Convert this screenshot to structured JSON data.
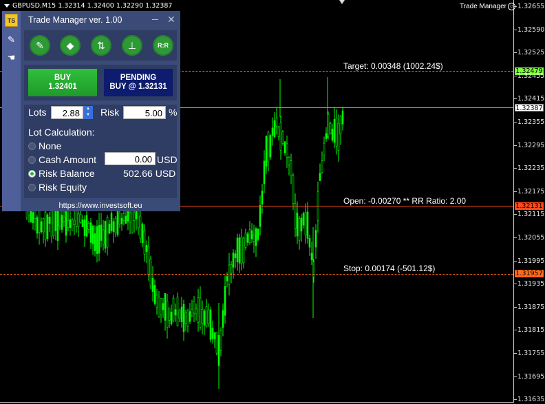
{
  "chart": {
    "symbol_line": "GBPUSD,M15  1.32314 1.32400 1.32290 1.32387",
    "ea_name": "Trade Manager",
    "ea_icon": "smile-icon",
    "price_axis": [
      "1.32655",
      "1.32590",
      "1.32525",
      "1.32455",
      "1.32415",
      "1.32355",
      "1.32295",
      "1.32235",
      "1.32175",
      "1.32115",
      "1.32055",
      "1.31995",
      "1.31935",
      "1.31875",
      "1.31815",
      "1.31755",
      "1.31695",
      "1.31635"
    ],
    "current_price_tag": "1.32387",
    "target_price_tag": "1.32479",
    "open_price_tag": "1.32131",
    "stop_price_tag": "1.31957",
    "target_text": "Target: 0.00348 (1002.24$)",
    "open_text": "Open: -0.00270 ** RR Ratio: 2.00",
    "stop_text": "Stop: 0.00174 (-501.12$)",
    "colors": {
      "candle": "#00ff00",
      "target": "#4caf50",
      "open": "#ff4a1a",
      "stop": "#ff6a1a",
      "current": "#9aa0a6",
      "target_tag": "#7cff3a"
    }
  },
  "panel": {
    "title": "Trade Manager ver. 1.00",
    "strip_icons": [
      "logo-icon",
      "edit-icon",
      "hand-icon"
    ],
    "logo_text": "TS",
    "tools": [
      "pencil-icon",
      "eraser-icon",
      "refresh-icon",
      "level-icon",
      "rr-icon"
    ],
    "rr_label": "R:R",
    "buy_line1": "BUY",
    "buy_line2": "1.32401",
    "pending_line1": "PENDING",
    "pending_line2": "BUY @ 1.32131",
    "lots_label": "Lots",
    "lots_value": "2.88",
    "risk_label": "Risk",
    "risk_value": "5.00",
    "risk_unit": "%",
    "lot_calc_label": "Lot Calculation:",
    "opt_none": "None",
    "opt_cash": "Cash Amount",
    "cash_value": "0.00",
    "cash_unit": "USD",
    "opt_risk_balance": "Risk Balance",
    "risk_balance_value": "502.66 USD",
    "opt_risk_equity": "Risk Equity",
    "selected_option": "Risk Balance",
    "link": "https://www.investsoft.eu"
  }
}
